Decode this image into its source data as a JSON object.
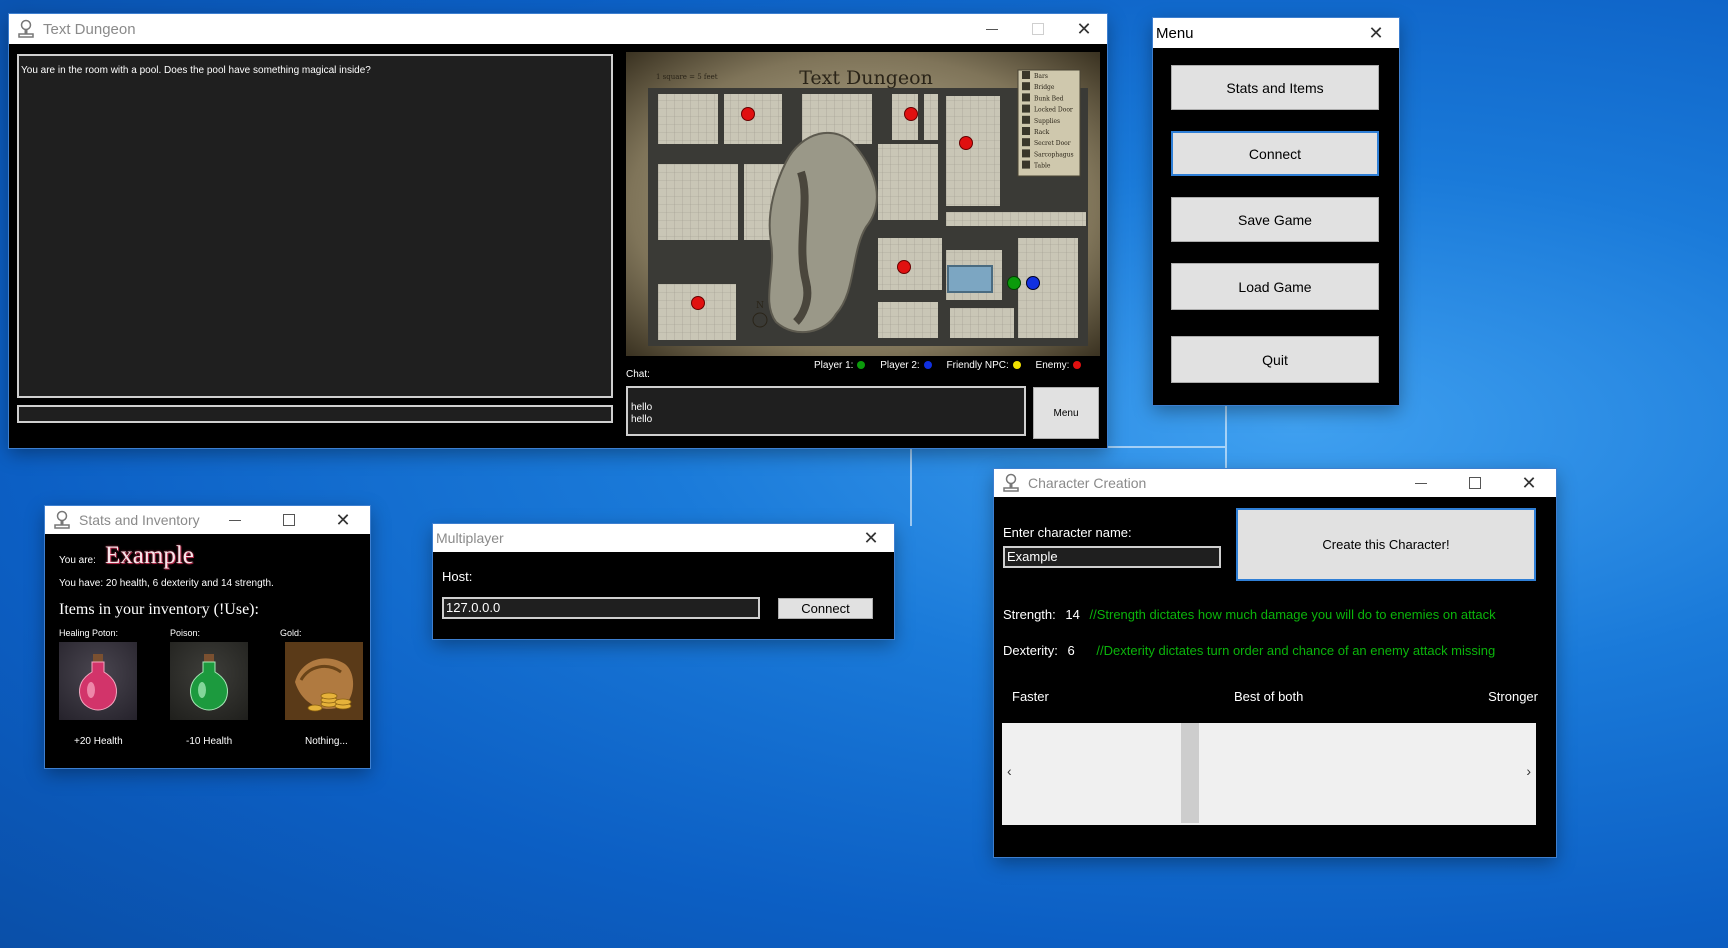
{
  "colors": {
    "player1": "#0b9b0b",
    "player2": "#1030e0",
    "friendly": "#f0e000",
    "enemy": "#e01010"
  },
  "main": {
    "title": "Text Dungeon",
    "log_text": "You are in the room with a pool. Does the pool have something magical inside?",
    "input_value": "",
    "chat_label": "Chat:",
    "chat_text": "hello\nhello",
    "menu_button": "Menu",
    "map": {
      "title": "Text Dungeon",
      "scale": "1 square = 5 feet",
      "legend": [
        "Bars",
        "Bridge",
        "Bunk Bed",
        "Locked Door",
        "Supplies",
        "Rack",
        "Secret Door",
        "Sarcophagus",
        "Table"
      ],
      "compass": "N"
    },
    "key": {
      "player1": "Player 1:",
      "player2": "Player 2:",
      "friendly": "Friendly NPC:",
      "enemy": "Enemy:"
    }
  },
  "menu": {
    "title": "Menu",
    "buttons": [
      "Stats and Items",
      "Connect",
      "Save Game",
      "Load Game",
      "Quit"
    ]
  },
  "stats": {
    "title": "Stats and Inventory",
    "you_are": "You are:",
    "name": "Example",
    "summary": "You have: 20 health, 6 dexterity and 14 strength.",
    "inv_title": "Items in your inventory (!Use):",
    "items": [
      {
        "label": "Healing Poton:",
        "effect": "+20 Health",
        "icon": "red-potion-icon"
      },
      {
        "label": "Poison:",
        "effect": "-10 Health",
        "icon": "green-potion-icon"
      },
      {
        "label": "Gold:",
        "effect": "Nothing...",
        "icon": "gold-bag-icon"
      }
    ]
  },
  "multiplayer": {
    "title": "Multiplayer",
    "host_label": "Host:",
    "host_value": "127.0.0.0",
    "connect": "Connect"
  },
  "creation": {
    "title": "Character Creation",
    "name_label": "Enter character name:",
    "name_value": "Example",
    "create_button": "Create this Character!",
    "strength_label": "Strength:",
    "strength_value": "14",
    "strength_comment": "//Strength dictates how much damage you will do to enemies on attack",
    "dex_label": "Dexterity:",
    "dex_value": "6",
    "dex_comment": "//Dexterity dictates turn order and chance of an enemy attack missing",
    "slider_left": "Faster",
    "slider_mid": "Best of both",
    "slider_right": "Stronger",
    "slider_fraction": 0.3
  }
}
